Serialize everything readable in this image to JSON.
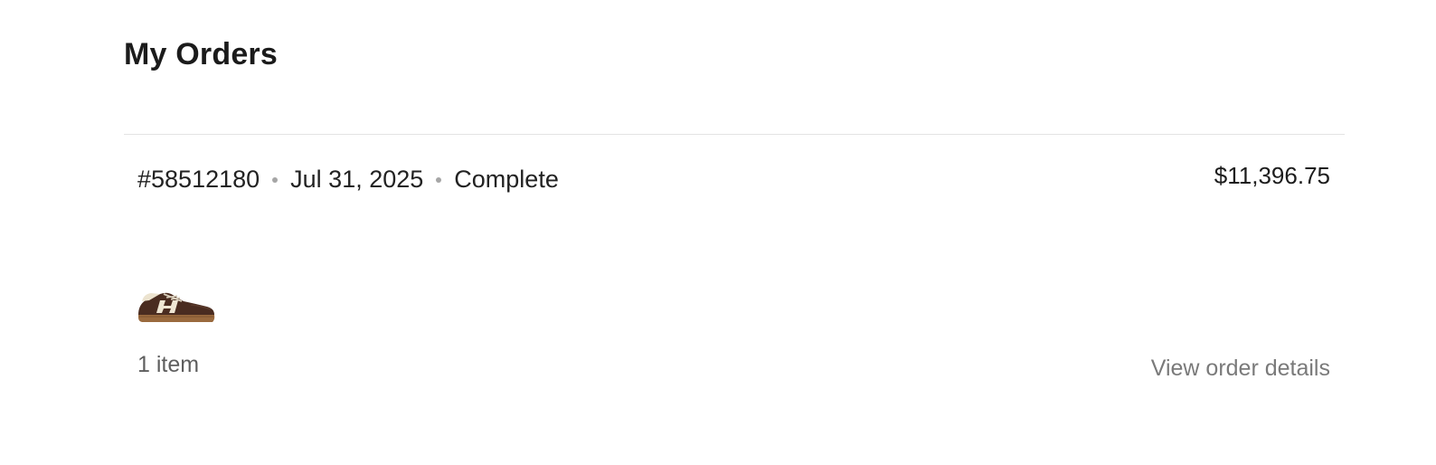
{
  "page": {
    "title": "My Orders"
  },
  "orders": [
    {
      "number": "#58512180",
      "date": "Jul 31, 2025",
      "status": "Complete",
      "total": "$11,396.75",
      "item_count_label": "1 item",
      "product_image": "brown-suede-sneaker",
      "view_details_label": "View order details"
    }
  ],
  "colors": {
    "text_primary": "#1f1f1f",
    "text_muted": "#5e5e5e",
    "link_muted": "#7a7a7a",
    "divider": "#e3e3e3",
    "dot": "#a6a6a6"
  }
}
